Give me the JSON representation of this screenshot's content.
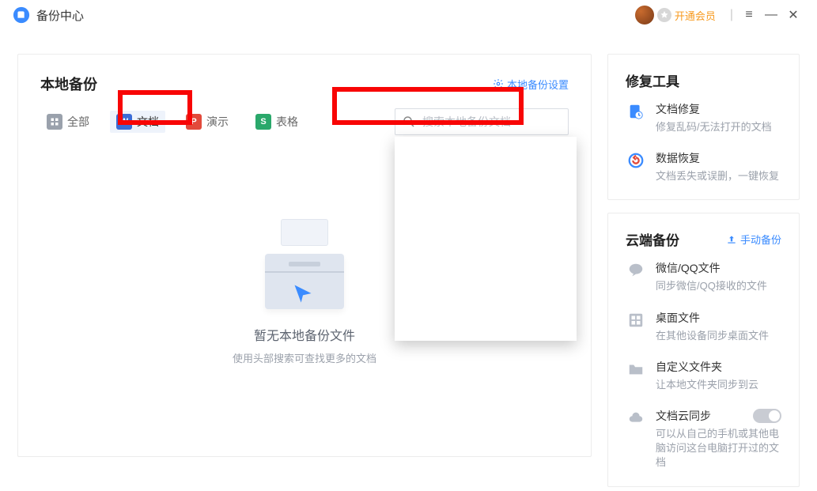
{
  "titlebar": {
    "app_name": "备份中心",
    "vip_text": "开通会员",
    "menu_glyph": "≡",
    "minimize_glyph": "—",
    "close_glyph": "✕"
  },
  "local_backup": {
    "heading": "本地备份",
    "settings_link": "本地备份设置",
    "filters": {
      "all": "全部",
      "doc": "文档",
      "ppt": "演示",
      "xls": "表格",
      "doc_letter": "W",
      "ppt_letter": "P",
      "xls_letter": "S"
    },
    "search_placeholder": "搜索本地备份文档",
    "empty_title": "暂无本地备份文件",
    "empty_sub": "使用头部搜索可查找更多的文档"
  },
  "repair": {
    "heading": "修复工具",
    "doc_repair": {
      "title": "文档修复",
      "desc": "修复乱码/无法打开的文档"
    },
    "data_recover": {
      "title": "数据恢复",
      "desc": "文档丢失或误删，一键恢复"
    }
  },
  "cloud_backup": {
    "heading": "云端备份",
    "manual_link": "手动备份",
    "wechat": {
      "title": "微信/QQ文件",
      "desc": "同步微信/QQ接收的文件"
    },
    "desktop": {
      "title": "桌面文件",
      "desc": "在其他设备同步桌面文件"
    },
    "custom": {
      "title": "自定义文件夹",
      "desc": "让本地文件夹同步到云"
    },
    "sync": {
      "title": "文档云同步",
      "desc": "可以从自己的手机或其他电脑访问这台电脑打开过的文档"
    }
  }
}
